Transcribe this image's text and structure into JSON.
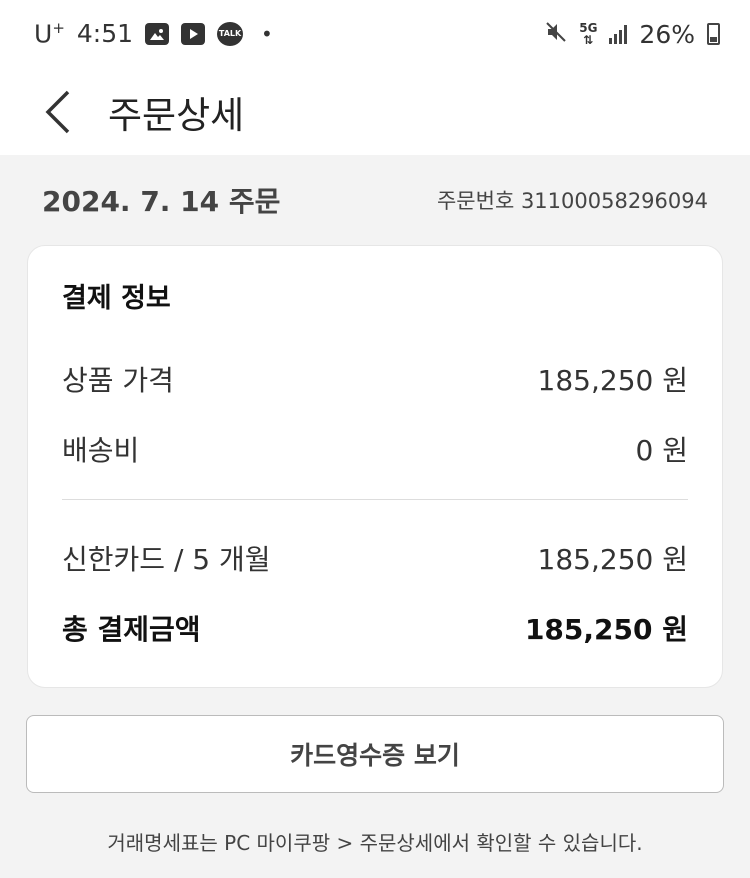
{
  "status_bar": {
    "carrier_base": "U",
    "carrier_sup": "+",
    "time": "4:51",
    "talk_label": "TALK",
    "dot": "•",
    "network": "5G",
    "battery": "26%"
  },
  "header": {
    "title": "주문상세"
  },
  "order": {
    "date": "2024. 7. 14 주문",
    "number": "주문번호 31100058296094"
  },
  "payment": {
    "title": "결제 정보",
    "rows": [
      {
        "label": "상품 가격",
        "value": "185,250 원"
      },
      {
        "label": "배송비",
        "value": "0 원"
      }
    ],
    "card_row": {
      "label": "신한카드 / 5 개월",
      "value": "185,250 원"
    },
    "total": {
      "label": "총 결제금액",
      "value": "185,250 원"
    }
  },
  "receipt_button": "카드영수증 보기",
  "note": "거래명세표는 PC 마이쿠팡 > 주문상세에서 확인할 수 있습니다."
}
